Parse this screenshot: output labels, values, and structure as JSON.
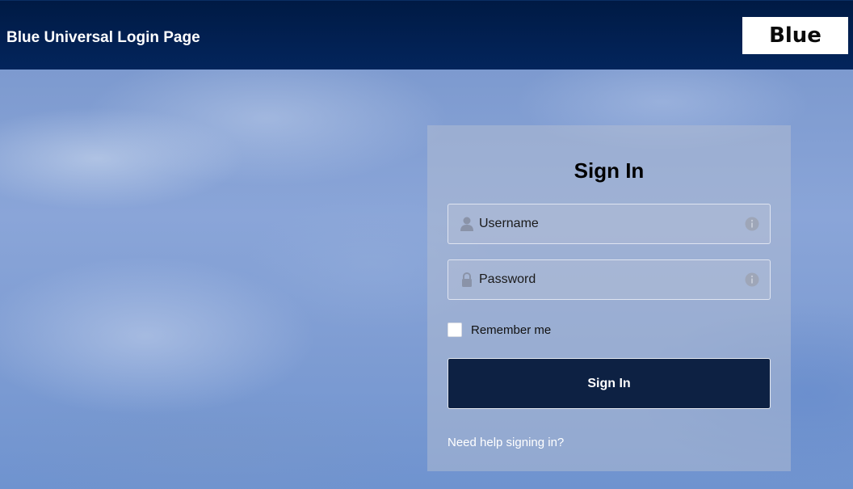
{
  "header": {
    "title": "Blue Universal Login Page",
    "logo_text": "Blue"
  },
  "login": {
    "heading": "Sign In",
    "username": {
      "value": "",
      "placeholder": "Username",
      "icon": "user-icon",
      "info_icon": "info-icon"
    },
    "password": {
      "value": "",
      "placeholder": "Password",
      "icon": "lock-icon",
      "info_icon": "info-icon"
    },
    "remember_me": {
      "label": "Remember me",
      "checked": false
    },
    "submit_label": "Sign In",
    "help_link": "Need help signing in?"
  },
  "colors": {
    "header_bg": "#002050",
    "button_bg": "#0d2143",
    "logo_bg": "#ffffff"
  }
}
